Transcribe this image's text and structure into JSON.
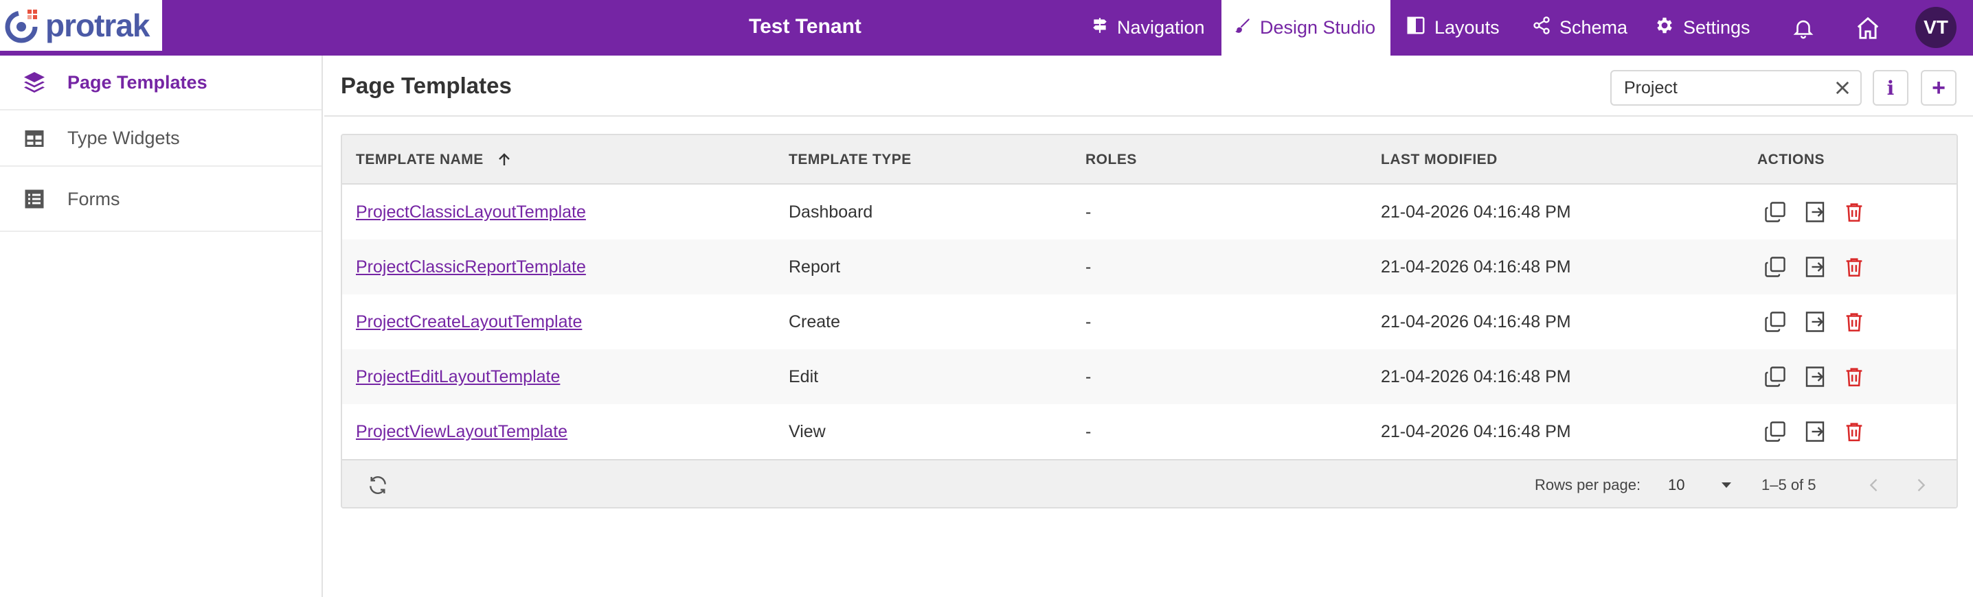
{
  "app": {
    "logo_text": "protrak",
    "tenant": "Test Tenant",
    "avatar_initials": "VT",
    "brand_color": "#7525a4"
  },
  "nav": [
    {
      "label": "Navigation",
      "icon": "signpost-icon"
    },
    {
      "label": "Design Studio",
      "icon": "brush-icon",
      "active": true
    },
    {
      "label": "Layouts",
      "icon": "layout-icon"
    },
    {
      "label": "Schema",
      "icon": "share-icon"
    },
    {
      "label": "Settings",
      "icon": "gear-icon"
    }
  ],
  "sidebar": {
    "items": [
      {
        "label": "Page Templates",
        "icon": "layers-icon",
        "active": true
      },
      {
        "label": "Type Widgets",
        "icon": "table-icon"
      },
      {
        "label": "Forms",
        "icon": "list-icon"
      }
    ]
  },
  "main": {
    "title": "Page Templates",
    "search_value": "Project",
    "info_label": "i",
    "add_label": "+"
  },
  "table": {
    "columns": [
      "TEMPLATE NAME",
      "TEMPLATE TYPE",
      "ROLES",
      "LAST MODIFIED",
      "ACTIONS"
    ],
    "sort_column": "TEMPLATE NAME",
    "sort_direction": "ascending",
    "rows": [
      {
        "name": "ProjectClassicLayoutTemplate",
        "type": "Dashboard",
        "roles": "-",
        "modified": "21-04-2026 04:16:48 PM"
      },
      {
        "name": "ProjectClassicReportTemplate",
        "type": "Report",
        "roles": "-",
        "modified": "21-04-2026 04:16:48 PM"
      },
      {
        "name": "ProjectCreateLayoutTemplate",
        "type": "Create",
        "roles": "-",
        "modified": "21-04-2026 04:16:48 PM"
      },
      {
        "name": "ProjectEditLayoutTemplate",
        "type": "Edit",
        "roles": "-",
        "modified": "21-04-2026 04:16:48 PM"
      },
      {
        "name": "ProjectViewLayoutTemplate",
        "type": "View",
        "roles": "-",
        "modified": "21-04-2026 04:16:48 PM"
      }
    ]
  },
  "pagination": {
    "rows_per_page_label": "Rows per page:",
    "rows_per_page": "10",
    "range": "1–5 of 5"
  }
}
